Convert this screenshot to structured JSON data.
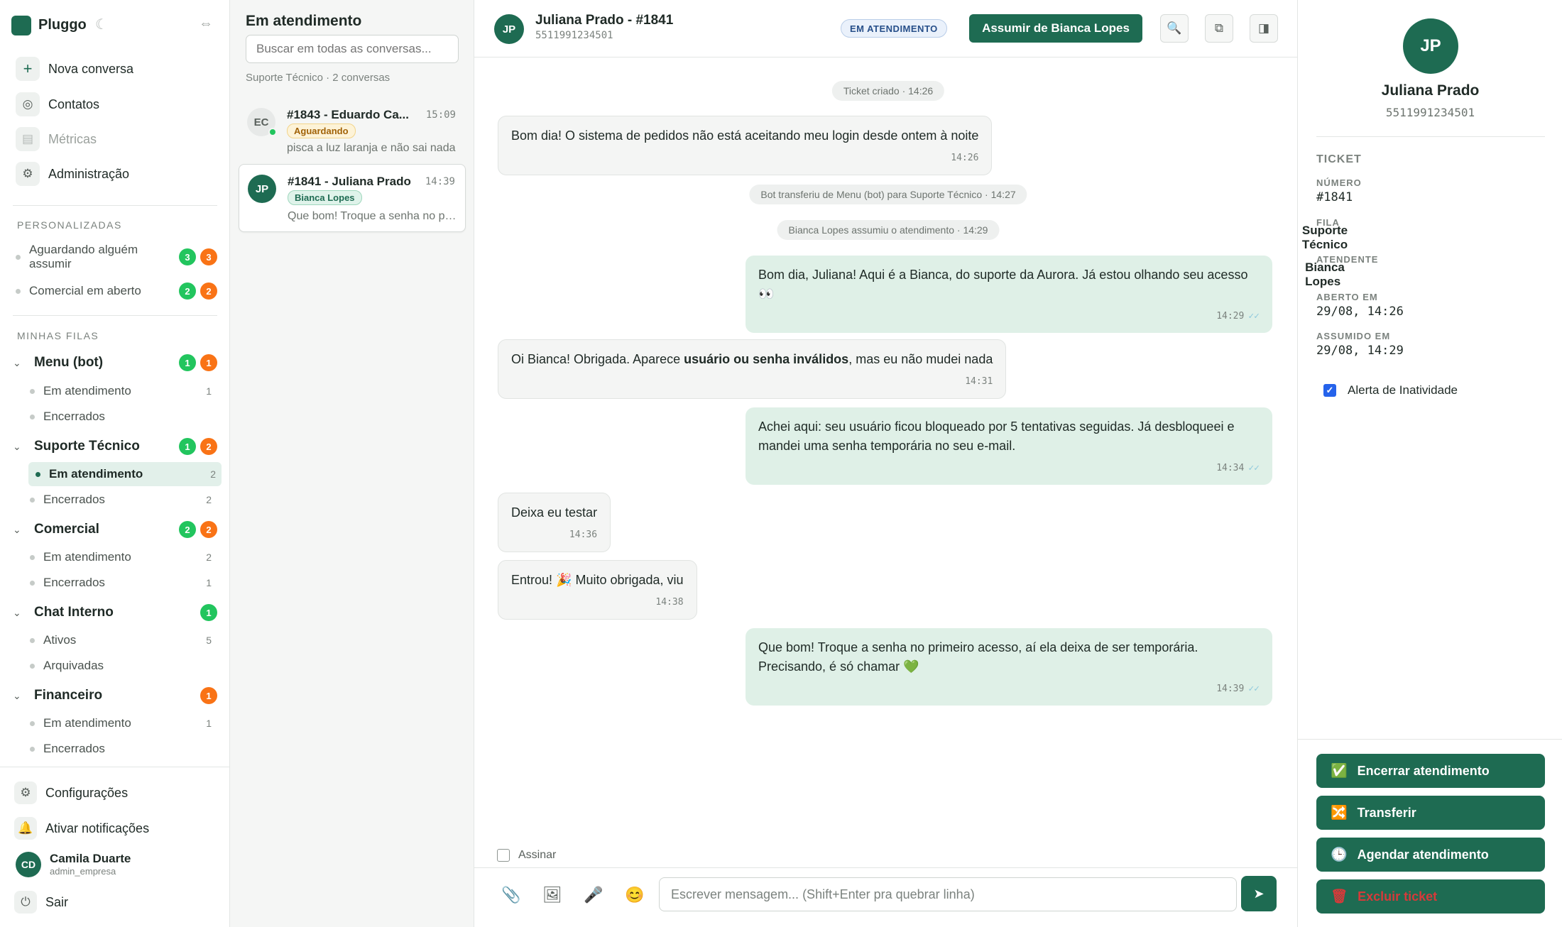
{
  "app": {
    "name": "Pluggo"
  },
  "nav": [
    {
      "label": "Nova conversa",
      "icon": "plus-icon"
    },
    {
      "label": "Contatos",
      "icon": "contacts-icon"
    },
    {
      "label": "Métricas",
      "icon": "metrics-icon"
    },
    {
      "label": "Administração",
      "icon": "gear-icon"
    }
  ],
  "personalizadas": {
    "title": "PERSONALIZADAS",
    "items": [
      {
        "label": "Aguardando alguém assumir",
        "green": "3",
        "orange": "3"
      },
      {
        "label": "Comercial em aberto",
        "green": "2",
        "orange": "2"
      }
    ]
  },
  "filas": {
    "title": "MINHAS FILAS",
    "queues": [
      {
        "name": "Menu (bot)",
        "green": "1",
        "orange": "1",
        "subs": [
          {
            "label": "Em atendimento",
            "count": "1"
          },
          {
            "label": "Encerrados",
            "count": ""
          }
        ]
      },
      {
        "name": "Suporte Técnico",
        "green": "1",
        "orange": "2",
        "subs": [
          {
            "label": "Em atendimento",
            "count": "2"
          },
          {
            "label": "Encerrados",
            "count": "2"
          }
        ]
      },
      {
        "name": "Comercial",
        "green": "2",
        "orange": "2",
        "subs": [
          {
            "label": "Em atendimento",
            "count": "2"
          },
          {
            "label": "Encerrados",
            "count": "1"
          }
        ]
      },
      {
        "name": "Chat Interno",
        "green": "1",
        "orange": "",
        "subs": [
          {
            "label": "Ativos",
            "count": "5"
          },
          {
            "label": "Arquivadas",
            "count": ""
          }
        ]
      },
      {
        "name": "Financeiro",
        "green": "",
        "orange": "1",
        "subs": [
          {
            "label": "Em atendimento",
            "count": "1"
          },
          {
            "label": "Encerrados",
            "count": ""
          }
        ]
      }
    ]
  },
  "footer": {
    "settings": "Configurações",
    "notifications": "Ativar notificações",
    "user_initials": "CD",
    "user_name": "Camila Duarte",
    "user_role": "admin_empresa",
    "logout": "Sair"
  },
  "conversations": {
    "title": "Em atendimento",
    "search_placeholder": "Buscar em todas as conversas...",
    "subtitle": "Suporte Técnico · 2 conversas",
    "items": [
      {
        "initials": "EC",
        "title": "#1843 - Eduardo Ca...",
        "time": "15:09",
        "tag": "Aguardando",
        "preview": "pisca a luz laranja e não sai nada"
      },
      {
        "initials": "JP",
        "title": "#1841 - Juliana Prado",
        "time": "14:39",
        "tag": "Bianca Lopes",
        "preview": "Que bom! Troque a senha no primeiro acesso"
      }
    ]
  },
  "chat": {
    "initials": "JP",
    "title": "Juliana Prado - #1841",
    "phone": "5511991234501",
    "status": "EM ATENDIMENTO",
    "assume_label": "Assumir de Bianca Lopes",
    "system": [
      "Ticket criado · 14:26",
      "Bot transferiu de Menu (bot) para Suporte Técnico · 14:27",
      "Bianca Lopes assumiu o atendimento · 14:29"
    ],
    "messages": [
      {
        "text": "Bom dia! O sistema de pedidos não está aceitando meu login desde ontem à noite",
        "time": "14:26"
      },
      {
        "text": "Bom dia, Juliana! Aqui é a Bianca, do suporte da Aurora. Já estou olhando seu acesso 👀",
        "time": "14:29"
      },
      {
        "pre": "Oi Bianca! Obrigada. Aparece ",
        "bold": "usuário ou senha inválidos",
        "post": ", mas eu não mudei nada",
        "time": "14:31"
      },
      {
        "text": "Achei aqui: seu usuário ficou bloqueado por 5 tentativas seguidas. Já desbloqueei e mandei uma senha temporária no seu e-mail.",
        "time": "14:34"
      },
      {
        "text": "Deixa eu testar",
        "time": "14:36"
      },
      {
        "text": "Entrou! 🎉 Muito obrigada, viu",
        "time": "14:38"
      },
      {
        "text": "Que bom! Troque a senha no primeiro acesso, aí ela deixa de ser temporária. Precisando, é só chamar 💚",
        "time": "14:39"
      }
    ],
    "check": "✓✓",
    "sign_label": "Assinar",
    "composer_placeholder": "Escrever mensagem... (Shift+Enter pra quebrar linha)"
  },
  "details": {
    "initials": "JP",
    "name": "Juliana Prado",
    "phone": "5511991234501",
    "section": "TICKET",
    "fields": [
      {
        "label": "NÚMERO",
        "value": "#1841"
      },
      {
        "label": "FILA",
        "value": "Suporte Técnico"
      },
      {
        "label": "ATENDENTE",
        "value": "Bianca Lopes"
      },
      {
        "label": "ABERTO EM",
        "value": "29/08, 14:26"
      },
      {
        "label": "ASSUMIDO EM",
        "value": "29/08, 14:29"
      }
    ],
    "inactivity_alert": "Alerta de Inatividade",
    "actions": [
      {
        "label": "Encerrar atendimento",
        "emoji": "✅"
      },
      {
        "label": "Transferir",
        "emoji": "🔀"
      },
      {
        "label": "Agendar atendimento",
        "emoji": "🕒"
      },
      {
        "label": "Excluir ticket",
        "emoji": "🗑"
      }
    ]
  },
  "colors": {
    "brand": "#1e6b52",
    "green_badge": "#22c55e",
    "orange_badge": "#f97316",
    "danger": "#d63a3a"
  }
}
